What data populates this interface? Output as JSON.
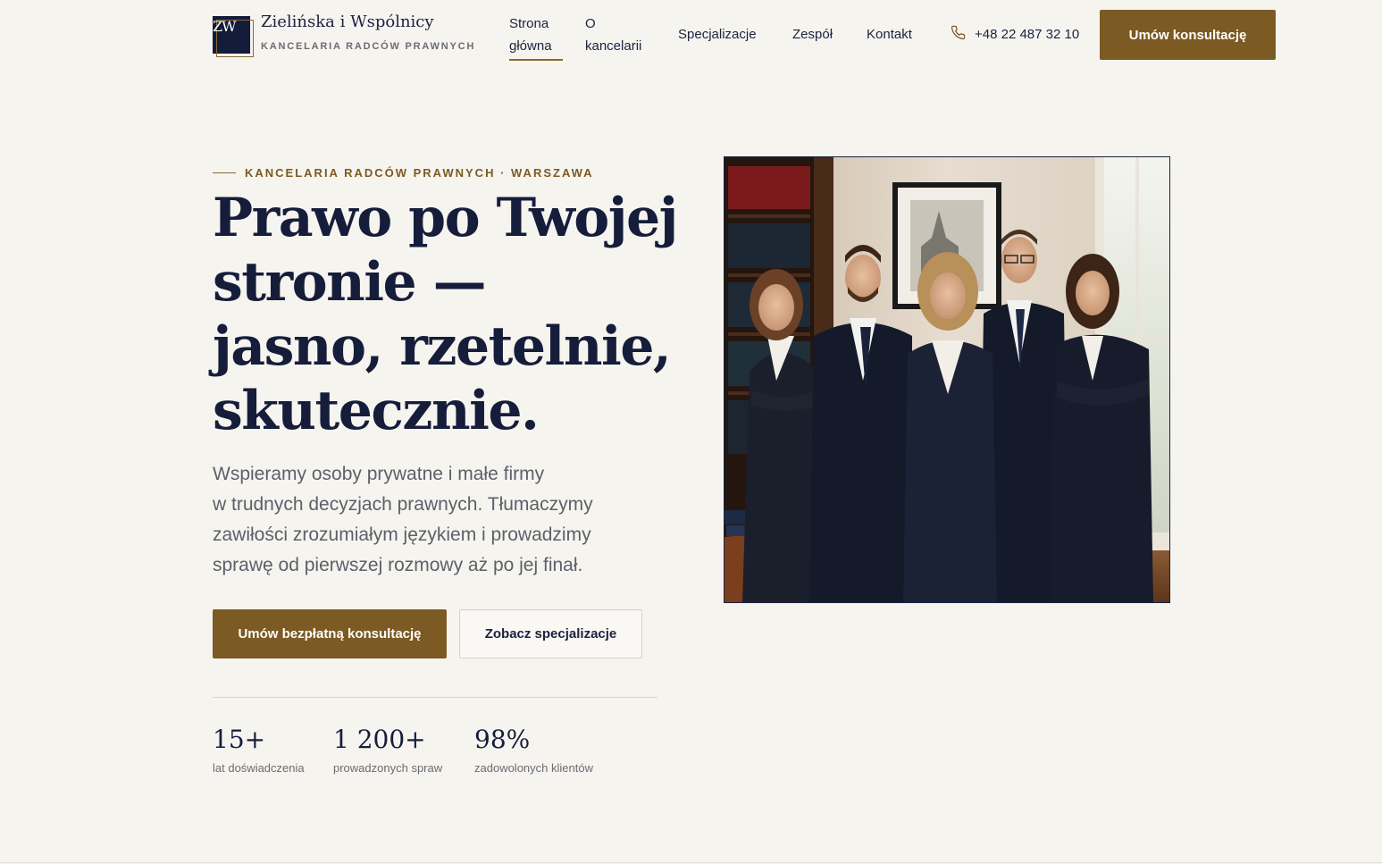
{
  "brand": {
    "initials": "ZW",
    "name": "Zielińska i Wspólnicy",
    "tagline": "KANCELARIA RADCÓW PRAWNYCH"
  },
  "nav": {
    "items": [
      {
        "label_l1": "Strona",
        "label_l2": "główna",
        "active": true
      },
      {
        "label_l1": "O",
        "label_l2": "kancelarii",
        "active": false
      },
      {
        "label": "Specjalizacje"
      },
      {
        "label": "Zespół"
      },
      {
        "label": "Kontakt"
      }
    ],
    "phone": "+48 22 487 32 10",
    "cta": "Umów konsultację"
  },
  "hero": {
    "eyebrow": "KANCELARIA RADCÓW PRAWNYCH · WARSZAWA",
    "headline_lines": [
      "Prawo po Twojej",
      "stronie —",
      "jasno, rzetelnie,",
      "skutecznie."
    ],
    "lead_lines": [
      "Wspieramy osoby prywatne i małe firmy",
      "w trudnych decyzjach prawnych. Tłumaczymy",
      "zawiłości zrozumiałym językiem i prowadzimy",
      "sprawę od pierwszej rozmowy aż po jej finał."
    ],
    "primary_button": "Umów bezpłatną konsultację",
    "secondary_button": "Zobacz specjalizacje"
  },
  "stats": [
    {
      "value": "15+",
      "label": "lat doświadczenia"
    },
    {
      "value": "1 200+",
      "label": "prowadzonych spraw"
    },
    {
      "value": "98%",
      "label": "zadowolonych klientów"
    }
  ],
  "colors": {
    "background": "#f6f4ef",
    "navy": "#161d3b",
    "gold": "#7c5a23"
  },
  "icons": {
    "phone": "phone-icon"
  }
}
